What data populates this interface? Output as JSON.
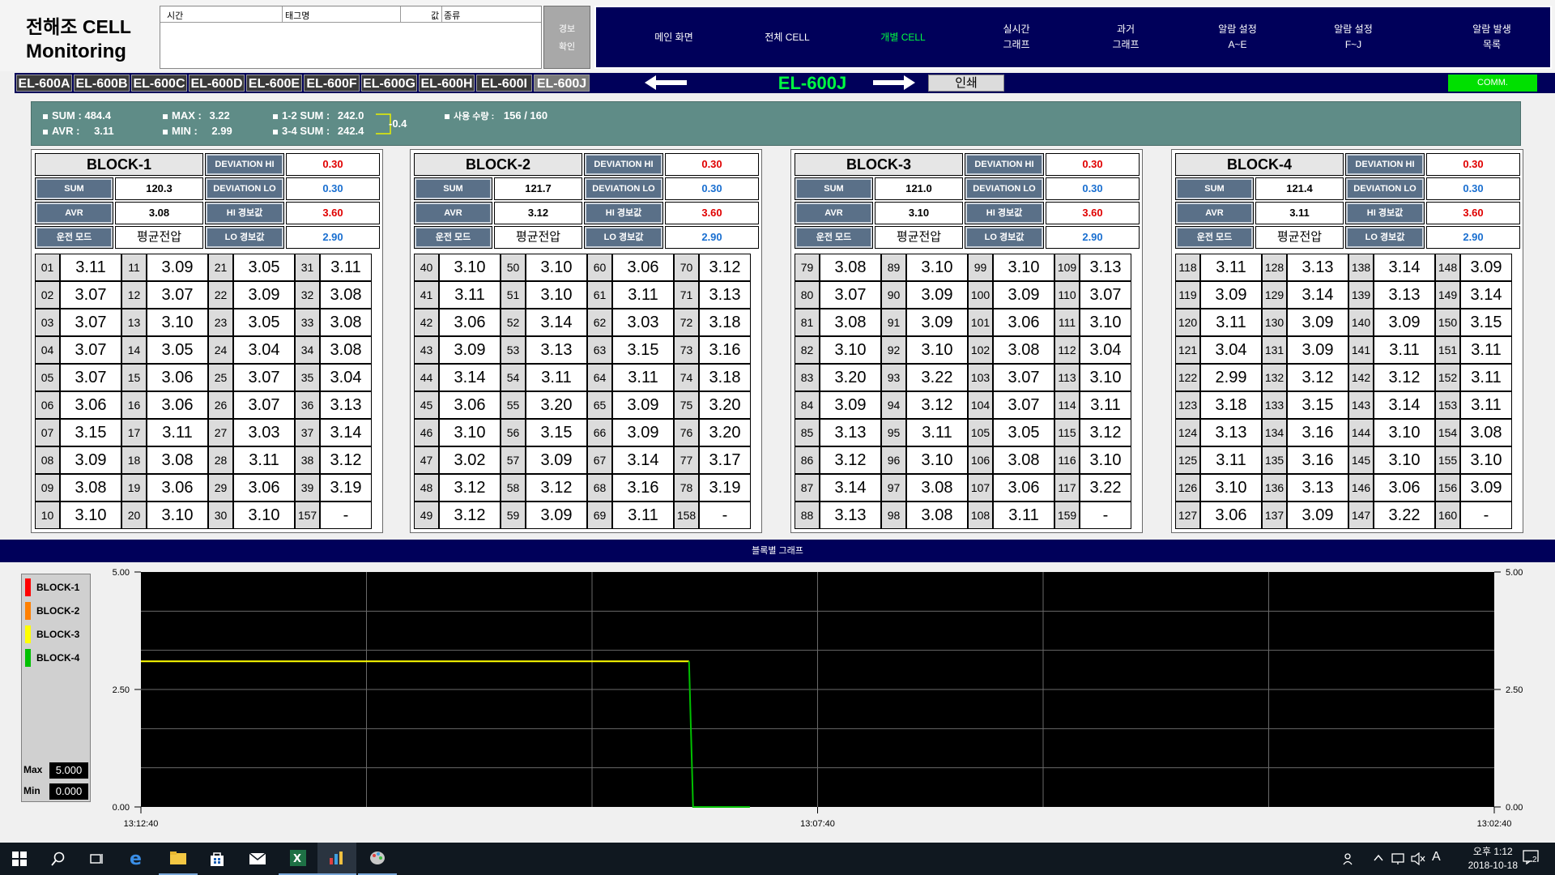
{
  "header": {
    "title_line1": "전해조 CELL",
    "title_line2": "Monitoring"
  },
  "alarm_table": {
    "columns": [
      "시간",
      "태그명",
      "값",
      "종류"
    ]
  },
  "ack_button": {
    "line1": "경보",
    "line2": "확인"
  },
  "menu": [
    {
      "label": "메인 화면",
      "active": false
    },
    {
      "label": "전체 CELL",
      "active": false
    },
    {
      "label": "개별 CELL",
      "active": true
    },
    {
      "label": "실시간\n그래프",
      "active": false
    },
    {
      "label": "과거\n그래프",
      "active": false
    },
    {
      "label": "알람 설정\nA~E",
      "active": false
    },
    {
      "label": "알람 설정\nF~J",
      "active": false
    },
    {
      "label": "알람 발생\n목록",
      "active": false
    }
  ],
  "tabs": [
    "EL-600A",
    "EL-600B",
    "EL-600C",
    "EL-600D",
    "EL-600E",
    "EL-600F",
    "EL-600G",
    "EL-600H",
    "EL-600I",
    "EL-600J"
  ],
  "selected_tab": "EL-600J",
  "current": {
    "name": "EL-600J",
    "print_label": "인쇄",
    "comm_label": "COMM."
  },
  "summary": {
    "sum_label": "SUM :",
    "sum": "484.4",
    "avr_label": "AVR :",
    "avr": "3.11",
    "max_label": "MAX :",
    "max": "3.22",
    "min_label": "MIN :",
    "min": "2.99",
    "s12_label": "1-2 SUM :",
    "s12": "242.0",
    "s34_label": "3-4 SUM :",
    "s34": "242.4",
    "diff": "-0.4",
    "usage_label": "사용 수량 :",
    "usage": "156 / 160"
  },
  "labels": {
    "dev_hi": "DEVIATION HI",
    "dev_lo": "DEVIATION LO",
    "hi_alarm": "HI 경보값",
    "lo_alarm": "LO 경보값",
    "sum": "SUM",
    "avr": "AVR",
    "mode": "운전 모드"
  },
  "blocks": [
    {
      "title": "BLOCK-1",
      "dev_hi": "0.30",
      "dev_lo": "0.30",
      "hi_alarm": "3.60",
      "lo_alarm": "2.90",
      "sum": "120.3",
      "avr": "3.08",
      "mode": "평균전압",
      "cols": [
        [
          [
            "01",
            "3.11"
          ],
          [
            "02",
            "3.07"
          ],
          [
            "03",
            "3.07"
          ],
          [
            "04",
            "3.07"
          ],
          [
            "05",
            "3.07"
          ],
          [
            "06",
            "3.06"
          ],
          [
            "07",
            "3.15"
          ],
          [
            "08",
            "3.09"
          ],
          [
            "09",
            "3.08"
          ],
          [
            "10",
            "3.10"
          ]
        ],
        [
          [
            "11",
            "3.09"
          ],
          [
            "12",
            "3.07"
          ],
          [
            "13",
            "3.10"
          ],
          [
            "14",
            "3.05"
          ],
          [
            "15",
            "3.06"
          ],
          [
            "16",
            "3.06"
          ],
          [
            "17",
            "3.11"
          ],
          [
            "18",
            "3.08"
          ],
          [
            "19",
            "3.06"
          ],
          [
            "20",
            "3.10"
          ]
        ],
        [
          [
            "21",
            "3.05"
          ],
          [
            "22",
            "3.09"
          ],
          [
            "23",
            "3.05"
          ],
          [
            "24",
            "3.04"
          ],
          [
            "25",
            "3.07"
          ],
          [
            "26",
            "3.07"
          ],
          [
            "27",
            "3.03"
          ],
          [
            "28",
            "3.11"
          ],
          [
            "29",
            "3.06"
          ],
          [
            "30",
            "3.10"
          ]
        ],
        [
          [
            "31",
            "3.11"
          ],
          [
            "32",
            "3.08"
          ],
          [
            "33",
            "3.08"
          ],
          [
            "34",
            "3.08"
          ],
          [
            "35",
            "3.04"
          ],
          [
            "36",
            "3.13"
          ],
          [
            "37",
            "3.14"
          ],
          [
            "38",
            "3.12"
          ],
          [
            "39",
            "3.19"
          ],
          [
            "157",
            "-"
          ]
        ]
      ]
    },
    {
      "title": "BLOCK-2",
      "dev_hi": "0.30",
      "dev_lo": "0.30",
      "hi_alarm": "3.60",
      "lo_alarm": "2.90",
      "sum": "121.7",
      "avr": "3.12",
      "mode": "평균전압",
      "cols": [
        [
          [
            "40",
            "3.10"
          ],
          [
            "41",
            "3.11"
          ],
          [
            "42",
            "3.06"
          ],
          [
            "43",
            "3.09"
          ],
          [
            "44",
            "3.14"
          ],
          [
            "45",
            "3.06"
          ],
          [
            "46",
            "3.10"
          ],
          [
            "47",
            "3.02"
          ],
          [
            "48",
            "3.12"
          ],
          [
            "49",
            "3.12"
          ]
        ],
        [
          [
            "50",
            "3.10"
          ],
          [
            "51",
            "3.10"
          ],
          [
            "52",
            "3.14"
          ],
          [
            "53",
            "3.13"
          ],
          [
            "54",
            "3.11"
          ],
          [
            "55",
            "3.20"
          ],
          [
            "56",
            "3.15"
          ],
          [
            "57",
            "3.09"
          ],
          [
            "58",
            "3.12"
          ],
          [
            "59",
            "3.09"
          ]
        ],
        [
          [
            "60",
            "3.06"
          ],
          [
            "61",
            "3.11"
          ],
          [
            "62",
            "3.03"
          ],
          [
            "63",
            "3.15"
          ],
          [
            "64",
            "3.11"
          ],
          [
            "65",
            "3.09"
          ],
          [
            "66",
            "3.09"
          ],
          [
            "67",
            "3.14"
          ],
          [
            "68",
            "3.16"
          ],
          [
            "69",
            "3.11"
          ]
        ],
        [
          [
            "70",
            "3.12"
          ],
          [
            "71",
            "3.13"
          ],
          [
            "72",
            "3.18"
          ],
          [
            "73",
            "3.16"
          ],
          [
            "74",
            "3.18"
          ],
          [
            "75",
            "3.20"
          ],
          [
            "76",
            "3.20"
          ],
          [
            "77",
            "3.17"
          ],
          [
            "78",
            "3.19"
          ],
          [
            "158",
            "-"
          ]
        ]
      ]
    },
    {
      "title": "BLOCK-3",
      "dev_hi": "0.30",
      "dev_lo": "0.30",
      "hi_alarm": "3.60",
      "lo_alarm": "2.90",
      "sum": "121.0",
      "avr": "3.10",
      "mode": "평균전압",
      "cols": [
        [
          [
            "79",
            "3.08"
          ],
          [
            "80",
            "3.07"
          ],
          [
            "81",
            "3.08"
          ],
          [
            "82",
            "3.10"
          ],
          [
            "83",
            "3.20"
          ],
          [
            "84",
            "3.09"
          ],
          [
            "85",
            "3.13"
          ],
          [
            "86",
            "3.12"
          ],
          [
            "87",
            "3.14"
          ],
          [
            "88",
            "3.13"
          ]
        ],
        [
          [
            "89",
            "3.10"
          ],
          [
            "90",
            "3.09"
          ],
          [
            "91",
            "3.09"
          ],
          [
            "92",
            "3.10"
          ],
          [
            "93",
            "3.22"
          ],
          [
            "94",
            "3.12"
          ],
          [
            "95",
            "3.11"
          ],
          [
            "96",
            "3.10"
          ],
          [
            "97",
            "3.08"
          ],
          [
            "98",
            "3.08"
          ]
        ],
        [
          [
            "99",
            "3.10"
          ],
          [
            "100",
            "3.09"
          ],
          [
            "101",
            "3.06"
          ],
          [
            "102",
            "3.08"
          ],
          [
            "103",
            "3.07"
          ],
          [
            "104",
            "3.07"
          ],
          [
            "105",
            "3.05"
          ],
          [
            "106",
            "3.08"
          ],
          [
            "107",
            "3.06"
          ],
          [
            "108",
            "3.11"
          ]
        ],
        [
          [
            "109",
            "3.13"
          ],
          [
            "110",
            "3.07"
          ],
          [
            "111",
            "3.10"
          ],
          [
            "112",
            "3.04"
          ],
          [
            "113",
            "3.10"
          ],
          [
            "114",
            "3.11"
          ],
          [
            "115",
            "3.12"
          ],
          [
            "116",
            "3.10"
          ],
          [
            "117",
            "3.22"
          ],
          [
            "159",
            "-"
          ]
        ]
      ]
    },
    {
      "title": "BLOCK-4",
      "dev_hi": "0.30",
      "dev_lo": "0.30",
      "hi_alarm": "3.60",
      "lo_alarm": "2.90",
      "sum": "121.4",
      "avr": "3.11",
      "mode": "평균전압",
      "cols": [
        [
          [
            "118",
            "3.11"
          ],
          [
            "119",
            "3.09"
          ],
          [
            "120",
            "3.11"
          ],
          [
            "121",
            "3.04"
          ],
          [
            "122",
            "2.99"
          ],
          [
            "123",
            "3.18"
          ],
          [
            "124",
            "3.13"
          ],
          [
            "125",
            "3.11"
          ],
          [
            "126",
            "3.10"
          ],
          [
            "127",
            "3.06"
          ]
        ],
        [
          [
            "128",
            "3.13"
          ],
          [
            "129",
            "3.14"
          ],
          [
            "130",
            "3.09"
          ],
          [
            "131",
            "3.09"
          ],
          [
            "132",
            "3.12"
          ],
          [
            "133",
            "3.15"
          ],
          [
            "134",
            "3.16"
          ],
          [
            "135",
            "3.16"
          ],
          [
            "136",
            "3.13"
          ],
          [
            "137",
            "3.09"
          ]
        ],
        [
          [
            "138",
            "3.14"
          ],
          [
            "139",
            "3.13"
          ],
          [
            "140",
            "3.09"
          ],
          [
            "141",
            "3.11"
          ],
          [
            "142",
            "3.12"
          ],
          [
            "143",
            "3.14"
          ],
          [
            "144",
            "3.10"
          ],
          [
            "145",
            "3.10"
          ],
          [
            "146",
            "3.06"
          ],
          [
            "147",
            "3.22"
          ]
        ],
        [
          [
            "148",
            "3.09"
          ],
          [
            "149",
            "3.14"
          ],
          [
            "150",
            "3.15"
          ],
          [
            "151",
            "3.11"
          ],
          [
            "152",
            "3.11"
          ],
          [
            "153",
            "3.11"
          ],
          [
            "154",
            "3.08"
          ],
          [
            "155",
            "3.10"
          ],
          [
            "156",
            "3.09"
          ],
          [
            "160",
            "-"
          ]
        ]
      ]
    }
  ],
  "graph": {
    "title": "블록별 그래프",
    "legend": [
      {
        "name": "BLOCK-1",
        "color": "#ff0000"
      },
      {
        "name": "BLOCK-2",
        "color": "#ff8000"
      },
      {
        "name": "BLOCK-3",
        "color": "#ffff00"
      },
      {
        "name": "BLOCK-4",
        "color": "#00c000"
      }
    ],
    "max_label": "Max",
    "max": "5.000",
    "min_label": "Min",
    "min": "0.000"
  },
  "chart_data": {
    "type": "line",
    "x_ticks": [
      "13:12:40",
      "13:07:40",
      "13:02:40"
    ],
    "y_ticks": [
      "5.00",
      "2.50",
      "0.00"
    ],
    "ylim": [
      0,
      5
    ],
    "grid": true,
    "series": [
      {
        "name": "BLOCK-3",
        "color": "#ffff00",
        "points": [
          [
            0,
            3.1
          ],
          [
            0.405,
            3.1
          ]
        ]
      },
      {
        "name": "BLOCK-4",
        "color": "#00c000",
        "points": [
          [
            0.405,
            3.1
          ],
          [
            0.408,
            0
          ],
          [
            0.45,
            0
          ]
        ]
      }
    ]
  },
  "taskbar": {
    "time": "오후 1:12",
    "date": "2018-10-18",
    "notif_count": "2",
    "ime": "A"
  }
}
